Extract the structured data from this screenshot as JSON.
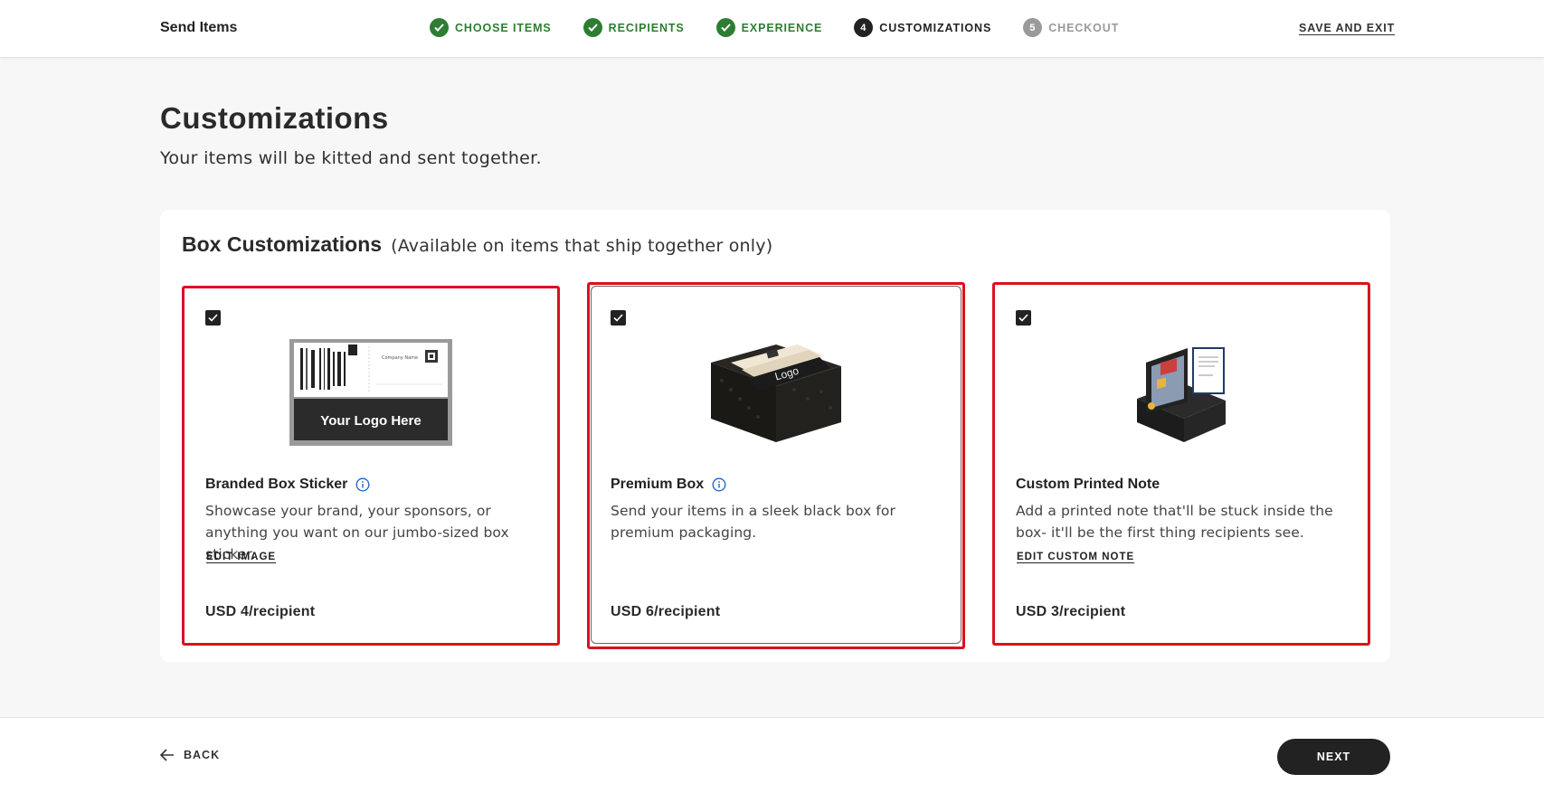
{
  "header": {
    "brand": "Send Items",
    "steps": [
      {
        "label": "CHOOSE ITEMS",
        "state": "done"
      },
      {
        "label": "RECIPIENTS",
        "state": "done"
      },
      {
        "label": "EXPERIENCE",
        "state": "done"
      },
      {
        "label": "CUSTOMIZATIONS",
        "state": "current",
        "number": "4"
      },
      {
        "label": "CHECKOUT",
        "state": "todo",
        "number": "5"
      }
    ],
    "save_exit": "SAVE AND EXIT"
  },
  "page": {
    "title": "Customizations",
    "subtitle": "Your items will be kitted and sent together."
  },
  "panel": {
    "title": "Box Customizations",
    "note": "(Available on items that ship together only)",
    "cards": [
      {
        "name": "Branded Box Sticker",
        "description": "Showcase your brand, your sponsors, or anything you want on our jumbo-sized box sticker.",
        "link": "EDIT IMAGE",
        "price": "USD 4/recipient",
        "checked": true,
        "image_text": "Your Logo Here",
        "image_small_text": "Company Name"
      },
      {
        "name": "Premium Box",
        "description": "Send your items in a sleek black box for premium packaging.",
        "link": "",
        "price": "USD 6/recipient",
        "checked": true,
        "image_text": "Logo"
      },
      {
        "name": "Custom Printed Note",
        "description": "Add a printed note that'll be stuck inside the box- it'll be the first thing recipients see.",
        "link": "EDIT CUSTOM NOTE",
        "price": "USD 3/recipient",
        "checked": true
      }
    ]
  },
  "footer": {
    "back": "BACK",
    "next": "NEXT"
  },
  "colors": {
    "done": "#2e7d32",
    "current": "#222222",
    "todo": "#9a9a9a",
    "highlight": "#d9121f"
  }
}
